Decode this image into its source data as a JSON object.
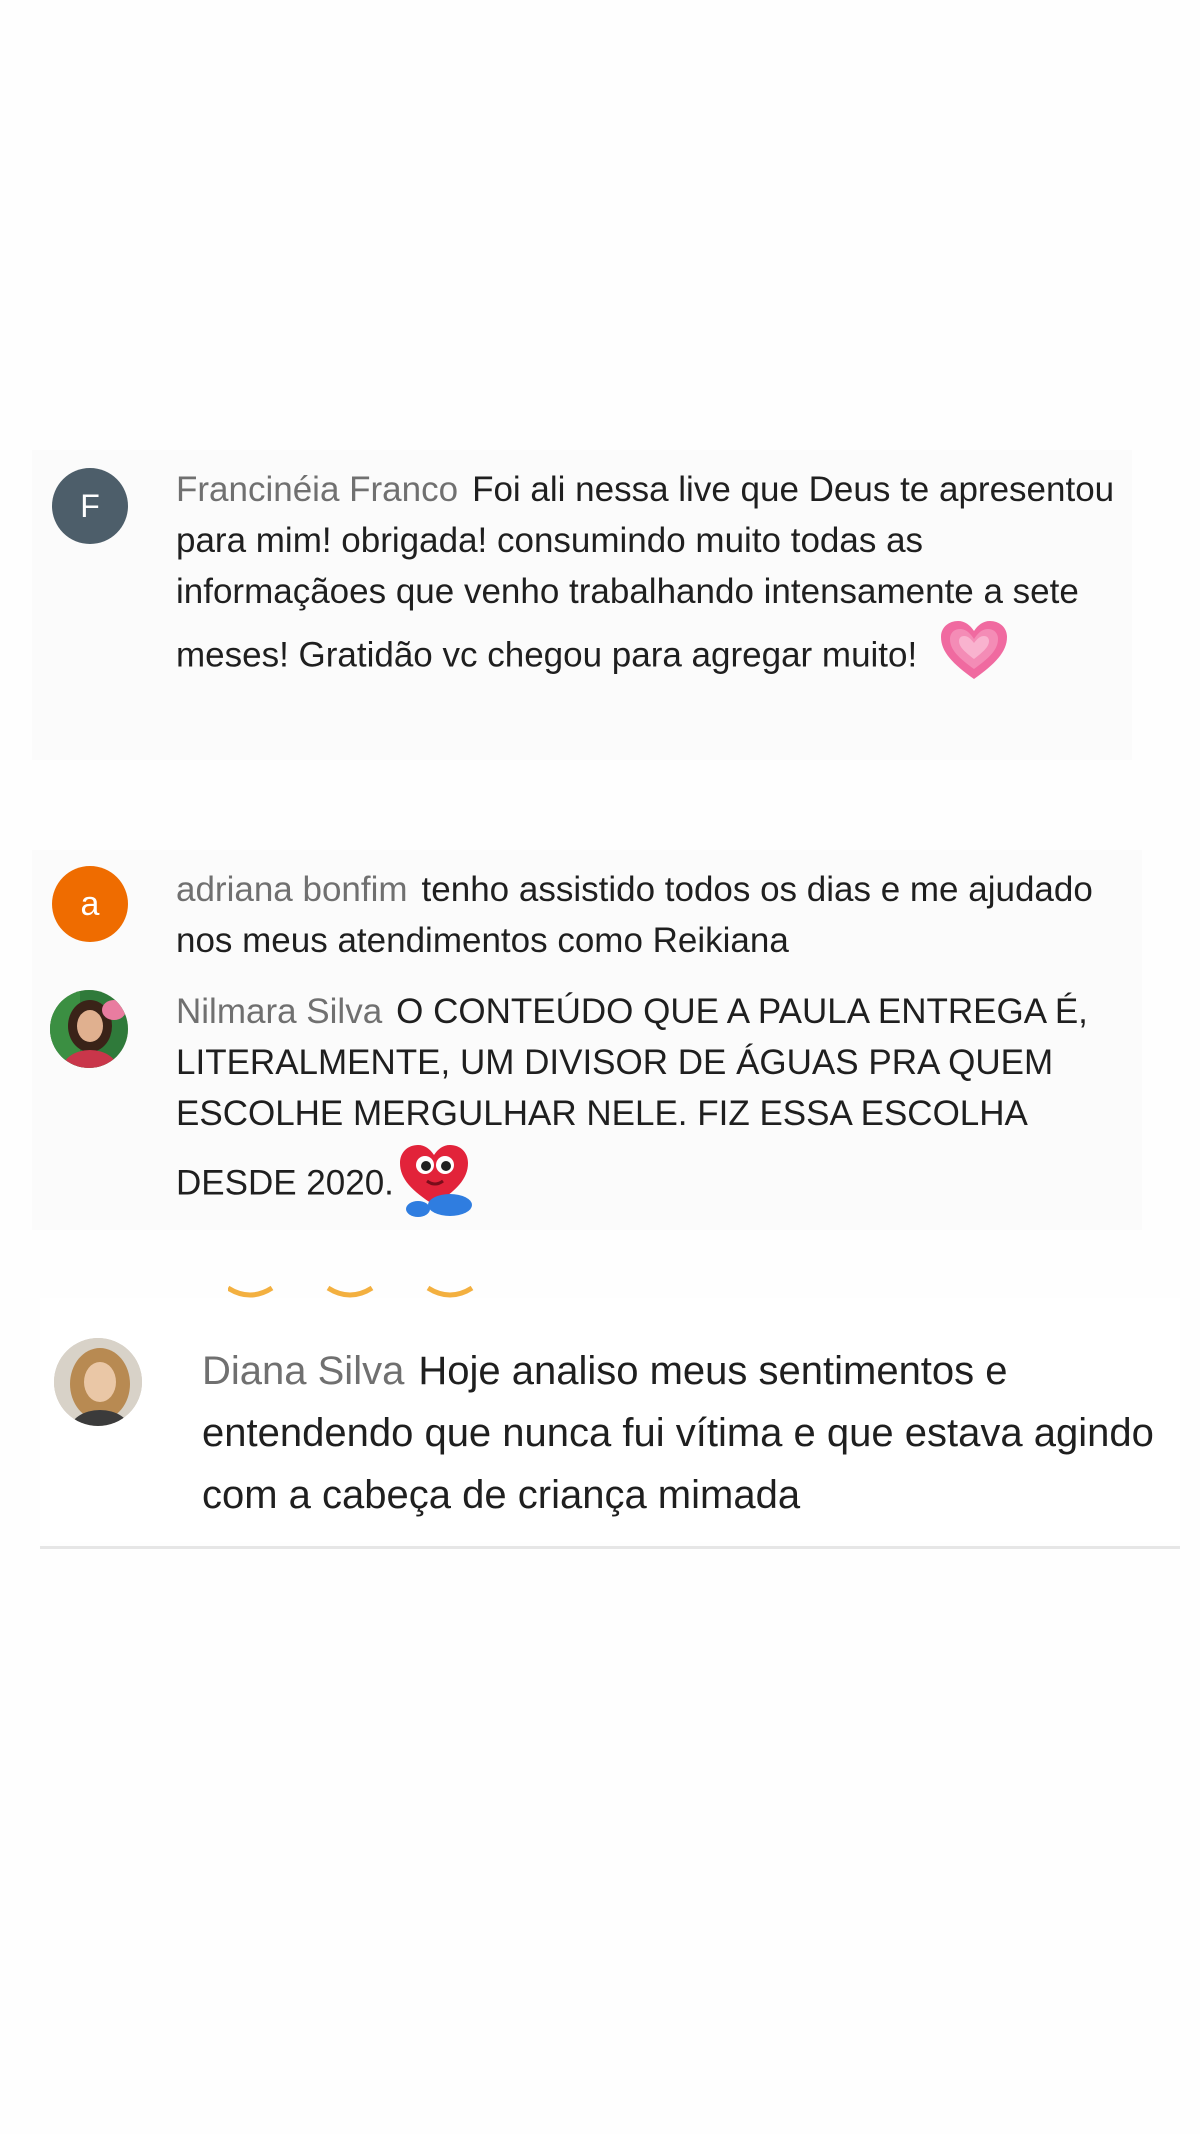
{
  "comments": [
    {
      "author": "Francinéia Franco",
      "avatar_letter": "F",
      "avatar_color": "#4d5e6a",
      "text": "Foi ali nessa live que Deus te apresentou para mim! obrigada! consumindo muito todas as informaçãoes que venho trabalhando intensamente a sete meses! Gratidão vc chegou para agregar muito!",
      "emoji": "pink-heart-icon"
    },
    {
      "author": "adriana bonfim",
      "avatar_letter": "a",
      "avatar_color": "#ef6c00",
      "text": "tenho assistido todos os dias e me ajudado nos meus atendimentos como Reikiana"
    },
    {
      "author": "Nilmara Silva",
      "avatar": "profile-photo",
      "text": "O CONTEÚDO QUE A PAULA ENTREGA É, LITERALMENTE, UM DIVISOR DE ÁGUAS PRA QUEM ESCOLHE MERGULHAR NELE. FIZ ESSA ESCOLHA DESDE 2020.",
      "emoji": "heart-character-icon"
    },
    {
      "author": "Diana Silva",
      "avatar": "profile-photo",
      "text": "Hoje analiso meus sentimentos e entendendo que nunca fui vítima e que estava agindo com a cabeça de criança mimada"
    }
  ],
  "colors": {
    "author_text": "#707070",
    "body_text": "#1f1f1f",
    "card_bg": "#fbfbfb",
    "page_bg": "#fefefe"
  }
}
